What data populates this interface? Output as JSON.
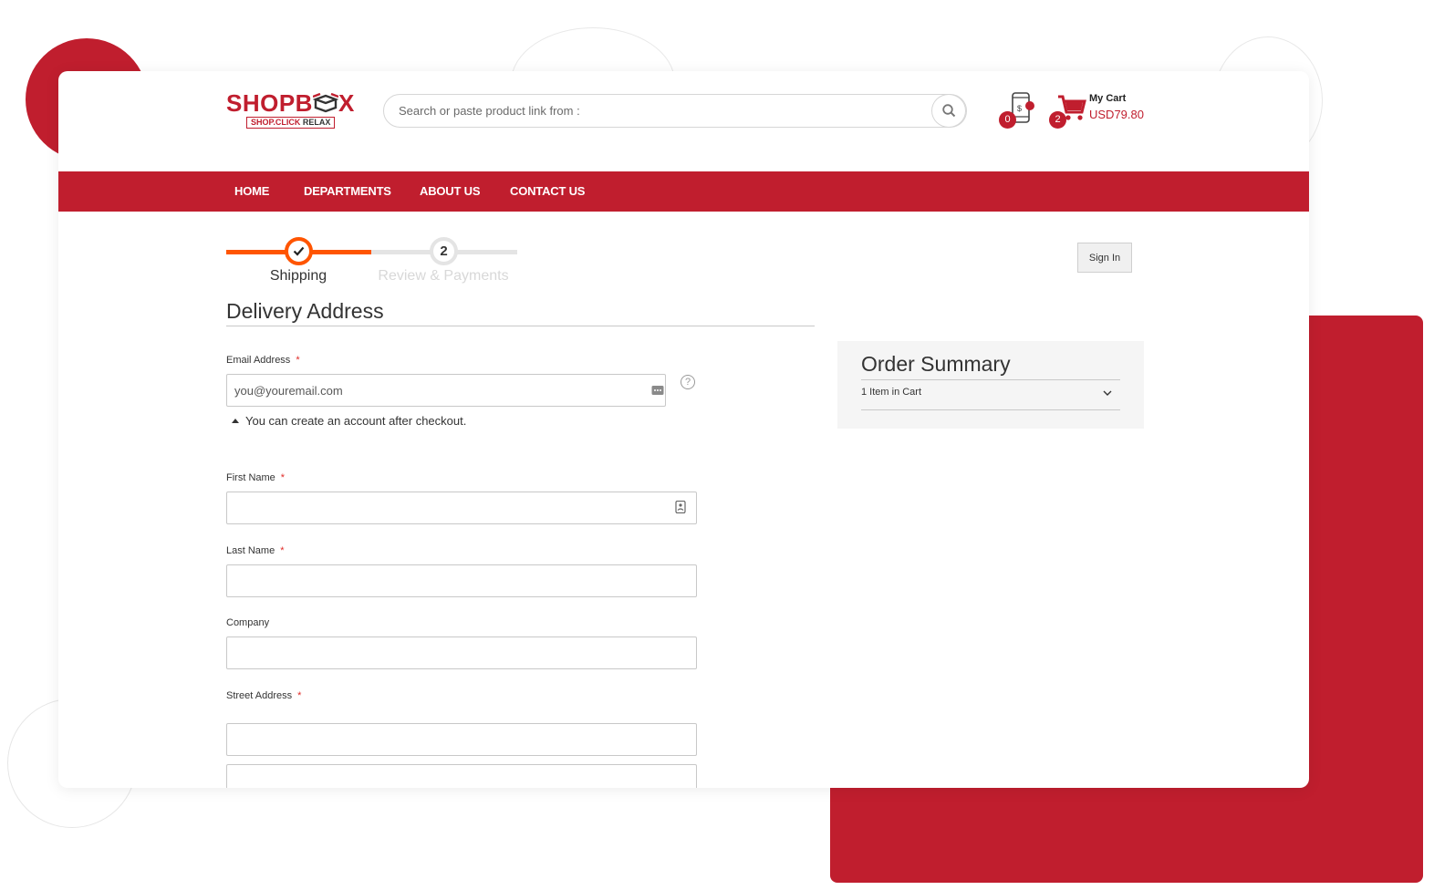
{
  "brand": {
    "name_left": "SHOPB",
    "name_right": "X",
    "tagline_left": "SHOP.CLICK ",
    "tagline_right": "RELAX",
    "color": "#c01e2e"
  },
  "search": {
    "placeholder": "Search or paste product link from :",
    "icon": "search-icon"
  },
  "wallet": {
    "icon": "wallet-phone-icon",
    "count": "0"
  },
  "cart": {
    "icon": "cart-icon",
    "count": "2",
    "label": "My Cart",
    "total": "USD79.80"
  },
  "nav": {
    "items": [
      "HOME",
      "DEPARTMENTS",
      "ABOUT US",
      "CONTACT US"
    ]
  },
  "progress": {
    "steps": [
      {
        "label": "Shipping",
        "status": "complete",
        "icon": "check-icon"
      },
      {
        "label": "Review & Payments",
        "status": "pending",
        "number": "2"
      }
    ],
    "active_color": "#ff5501"
  },
  "signin": {
    "label": "Sign In"
  },
  "form": {
    "title": "Delivery Address",
    "required_mark": "*",
    "email": {
      "label": "Email Address",
      "placeholder": "you@youremail.com",
      "note": "You can create an account after checkout.",
      "help": "?"
    },
    "first_name": {
      "label": "First Name",
      "value": ""
    },
    "last_name": {
      "label": "Last Name",
      "value": ""
    },
    "company": {
      "label": "Company",
      "value": ""
    },
    "street": {
      "label": "Street Address",
      "line1": "",
      "line2": ""
    }
  },
  "order_summary": {
    "title": "Order Summary",
    "items_label": "1 Item in Cart",
    "toggle_icon": "chevron-down-icon"
  }
}
